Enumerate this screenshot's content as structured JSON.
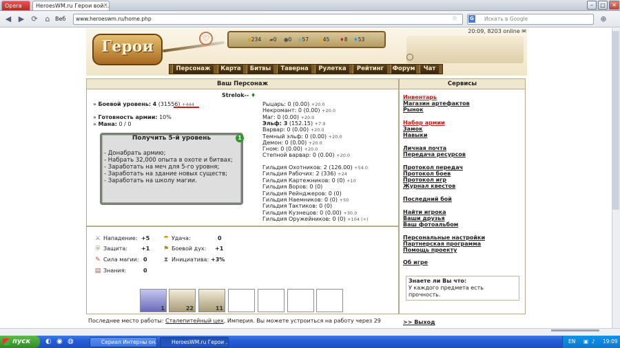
{
  "browser": {
    "opera_tab": "Opera",
    "active_tab": "HeroesWM.ru Герои вой...",
    "back_label": "Веб",
    "url": "www.heroeswm.ru/home.php",
    "search_placeholder": "Искать в Google"
  },
  "header": {
    "logo_text": "Герои",
    "online": "20:09, 8203 online",
    "resources": [
      {
        "icon": "gold-icon",
        "value": "234"
      },
      {
        "icon": "wood-icon",
        "value": "0"
      },
      {
        "icon": "ore-icon",
        "value": "0"
      },
      {
        "icon": "mercury-icon",
        "value": "57"
      },
      {
        "icon": "sulfur-icon",
        "value": "45"
      },
      {
        "icon": "crystal-icon",
        "value": "8"
      },
      {
        "icon": "gems-icon",
        "value": "53"
      }
    ],
    "menu": [
      "Персонаж",
      "Карта",
      "Битвы",
      "Таверна",
      "Рулетка",
      "Рейтинг",
      "Форум",
      "Чат"
    ]
  },
  "character": {
    "panel_title": "Ваш Персонаж",
    "name": "Strelok--",
    "combat_level_label": "Боевой уровень:",
    "combat_level": "4",
    "experience": "(31556)",
    "experience_gain": "+444",
    "readiness_label": "Готовность армии:",
    "readiness": "10%",
    "mana_label": "Мана:",
    "mana": "0 / 0"
  },
  "quest": {
    "title": "Получить 5-й уровень",
    "badge": "1",
    "lines": [
      "- Донабрать армию;",
      "- Набрать 32,000 опыта в охоте и битвах;",
      "- Заработать на меч для 5-го уровня;",
      "- Заработать на здание новых существ;",
      "- Заработать на школу магии."
    ]
  },
  "factions": [
    {
      "name": "Рыцарь:",
      "value": "0 (0.00)",
      "extra": "+20.0",
      "bold": false
    },
    {
      "name": "Некромант:",
      "value": "0 (0.00)",
      "extra": "+20.0",
      "bold": false
    },
    {
      "name": "Маг:",
      "value": "0 (0.00)",
      "extra": "+20.0",
      "bold": false
    },
    {
      "name": "Эльф: 3",
      "value": "(152.15)",
      "extra": "+7.9",
      "bold": true
    },
    {
      "name": "Варвар:",
      "value": "0 (0.00)",
      "extra": "+20.0",
      "bold": false
    },
    {
      "name": "Темный эльф:",
      "value": "0 (0.00)",
      "extra": "+20.0",
      "bold": false
    },
    {
      "name": "Демон:",
      "value": "0 (0.00)",
      "extra": "+20.0",
      "bold": false
    },
    {
      "name": "Гном:",
      "value": "0 (0.00)",
      "extra": "+20.0",
      "bold": false
    },
    {
      "name": "Степной варвар:",
      "value": "0 (0.00)",
      "extra": "+20.0",
      "bold": false
    }
  ],
  "guilds": [
    {
      "name": "Гильдия Охотников:",
      "value": "2 (126.00)",
      "extra": "+54.0"
    },
    {
      "name": "Гильдия Рабочих:",
      "value": "2 (336)",
      "extra": "+24"
    },
    {
      "name": "Гильдия Картежников:",
      "value": "0 (0)",
      "extra": "+10"
    },
    {
      "name": "Гильдия Воров:",
      "value": "0 (0)",
      "extra": ""
    },
    {
      "name": "Гильдия Рейнджеров:",
      "value": "0 (0)",
      "extra": ""
    },
    {
      "name": "Гильдия Наемников:",
      "value": "0 (0)",
      "extra": "+50"
    },
    {
      "name": "Гильдия Тактиков:",
      "value": "0 (0)",
      "extra": ""
    },
    {
      "name": "Гильдия Кузнецов:",
      "value": "0 (0.00)",
      "extra": "+30.0"
    },
    {
      "name": "Гильдия Оружейников:",
      "value": "0 (0)",
      "extra": "+104 (+)"
    }
  ],
  "stats": {
    "attack_label": "Нападение:",
    "attack": "+5",
    "defense_label": "Защита:",
    "defense": "+1",
    "spellpower_label": "Сила магии:",
    "spellpower": "0",
    "knowledge_label": "Знания:",
    "knowledge": "0",
    "luck_label": "Удача:",
    "luck": "0",
    "morale_label": "Боевой дух:",
    "morale": "+1",
    "initiative_label": "Инициатива:",
    "initiative": "+3%"
  },
  "army": [
    {
      "count": "1"
    },
    {
      "count": "22"
    },
    {
      "count": "11"
    }
  ],
  "services": {
    "title": "Сервисы",
    "links": [
      {
        "label": "Инвентарь",
        "red": true
      },
      {
        "label": "Магазин артефактов",
        "red": false
      },
      {
        "label": "Рынок",
        "red": false
      },
      {
        "label": "Набор армии",
        "red": true
      },
      {
        "label": "Замок",
        "red": false
      },
      {
        "label": "Навыки",
        "red": false
      },
      {
        "label": "Личная почта",
        "red": false
      },
      {
        "label": "Передача ресурсов",
        "red": false
      },
      {
        "label": "Протокол передач",
        "red": false
      },
      {
        "label": "Протокол боев",
        "red": false
      },
      {
        "label": "Протокол игр",
        "red": false
      },
      {
        "label": "Журнал квестов",
        "red": false
      },
      {
        "label": "Последний бой",
        "red": false
      },
      {
        "label": "Найти игрока",
        "red": false
      },
      {
        "label": "Ваши друзья",
        "red": false
      },
      {
        "label": "Ваш фотоальбом",
        "red": false
      },
      {
        "label": "Персональные настройки",
        "red": false
      },
      {
        "label": "Партнерская программа",
        "red": false
      },
      {
        "label": "Помощь проекту",
        "red": false
      },
      {
        "label": "Об игре",
        "red": false
      }
    ],
    "tip_title": "Знаете ли Вы что:",
    "tip_text": "У каждого предмета есть прочность.",
    "exit": ">> Выход"
  },
  "work": {
    "prefix": "Последнее место работы:",
    "place": "Сталепитейный цех",
    "suffix": ", Империя. Вы можете устроиться на работу через 29"
  },
  "taskbar": {
    "start": "пуск",
    "tasks": [
      "Сериал Интерны он...",
      "HeroesWM.ru Герои ..."
    ],
    "lang": "EN",
    "clock": "19:09"
  }
}
